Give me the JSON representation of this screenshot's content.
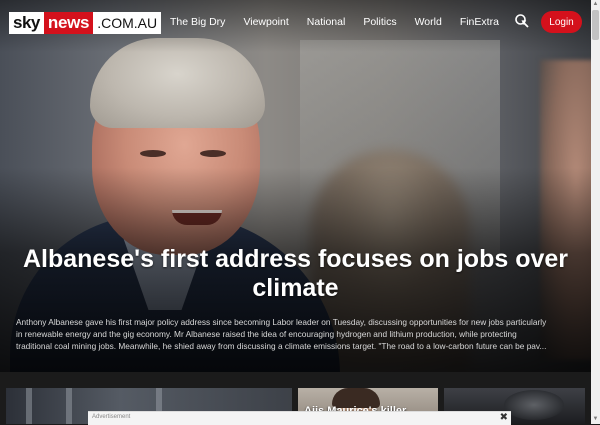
{
  "brand": {
    "part1": "sky",
    "part2": "news",
    "part3": ".COM.AU",
    "accent_color": "#d4111c"
  },
  "nav": {
    "items": [
      "The Big Dry",
      "Viewpoint",
      "National",
      "Politics",
      "World",
      "FinExtra"
    ],
    "dropdown_icon": "caret-down-icon"
  },
  "header_actions": {
    "search_icon": "search-icon",
    "login_label": "Login"
  },
  "article": {
    "headline": "Albanese's first address focuses on jobs over climate",
    "summary": "Anthony Albanese gave his first major policy address since becoming Labor leader on Tuesday, discussing opportunities for new jobs particularly\nin renewable energy and the gig economy. Mr Albanese raised the idea of encouraging hydrogen and lithium production, while protecting\ntraditional coal mining jobs. Meanwhile, he shied away from discussing a climate emissions target. \"The road to a low-carbon future can be pav..."
  },
  "cards": [
    {
      "title": ""
    },
    {
      "title": "Ajis Maurice's killer"
    },
    {
      "title": ""
    }
  ],
  "ad": {
    "label": "Advertisement",
    "close": "✖"
  }
}
